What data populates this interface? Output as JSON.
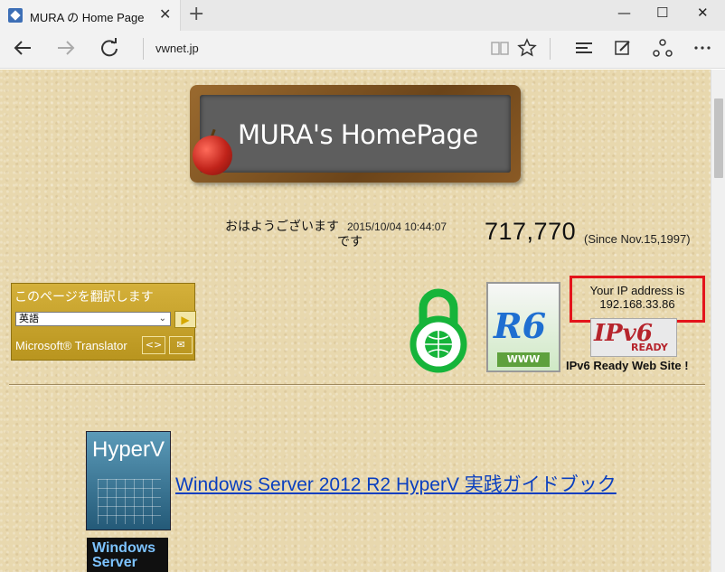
{
  "browser": {
    "tab_title": "MURA の Home Page",
    "tab_close": "✕",
    "new_tab": "+",
    "window_controls": {
      "minimize": "—",
      "maximize": "☐",
      "close": "✕"
    },
    "address": "vwnet.jp",
    "nav_icons": [
      "back-icon",
      "forward-icon",
      "refresh-icon"
    ],
    "tool_icons": [
      "reading-view-icon",
      "favorite-star-icon",
      "hub-icon",
      "web-note-icon",
      "share-icon",
      "more-icon"
    ]
  },
  "page": {
    "banner_title": "MURA's HomePage",
    "greeting_line1": "おはようございます",
    "greeting_line2": "です",
    "datetime": "2015/10/04 10:44:07",
    "visit_count": "717,770",
    "since": "(Since Nov.15,1997)",
    "translator": {
      "header": "このページを翻訳します",
      "language": "英語",
      "brand": "Microsoft® Translator"
    },
    "ip_box": {
      "line1": "Your IP address is",
      "line2": "192.168.33.86"
    },
    "badge_r6_text": "R6",
    "badge_www": "WWW",
    "ipv6_ready_big": "IPv6",
    "ipv6_ready_small": "READY",
    "ipv6_caption": "IPv6 Ready Web Site !",
    "book1_cover": "HyperV",
    "book1_link": "Windows Server 2012 R2 HyperV 実践ガイドブック",
    "book2_cover": "Windows Server"
  },
  "colors": {
    "page_bg": "#e8d8ae",
    "ip_box_border": "#e3141b",
    "link": "#0a3fbf",
    "translator_bg": "#c9a52f"
  }
}
